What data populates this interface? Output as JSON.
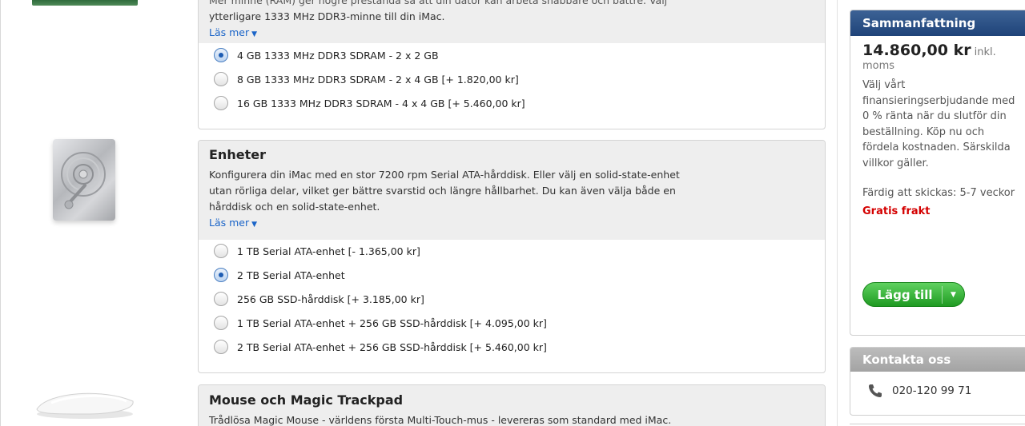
{
  "memory": {
    "desc_top": "Mer minne (RAM) ger högre prestanda så att din dator kan arbeta snabbare och bättre. Välj",
    "desc_line": "ytterligare 1333 MHz DDR3-minne till din iMac.",
    "learn_more": "Läs mer",
    "options": [
      {
        "label": "4 GB 1333 MHz DDR3 SDRAM - 2 x 2 GB",
        "checked": true
      },
      {
        "label": "8 GB 1333 MHz DDR3 SDRAM - 2 x 4 GB [+ 1.820,00 kr]",
        "checked": false
      },
      {
        "label": "16 GB 1333 MHz DDR3 SDRAM - 4 x 4 GB [+ 5.460,00 kr]",
        "checked": false
      }
    ]
  },
  "storage": {
    "title": "Enheter",
    "desc_lines": [
      "Konfigurera din iMac med en stor 7200 rpm Serial ATA-hårddisk. Eller välj en solid-state-enhet",
      "utan rörliga delar, vilket ger bättre svarstid och längre hållbarhet. Du kan även välja både en",
      "hårddisk och en solid-state-enhet."
    ],
    "learn_more": "Läs mer",
    "options": [
      {
        "label": "1 TB Serial ATA-enhet [- 1.365,00 kr]",
        "checked": false
      },
      {
        "label": "2 TB Serial ATA-enhet",
        "checked": true
      },
      {
        "label": "256 GB SSD-hårddisk [+ 3.185,00 kr]",
        "checked": false
      },
      {
        "label": "1 TB Serial ATA-enhet + 256 GB SSD-hårddisk [+ 4.095,00 kr]",
        "checked": false
      },
      {
        "label": "2 TB Serial ATA-enhet + 256 GB SSD-hårddisk [+ 5.460,00 kr]",
        "checked": false
      }
    ]
  },
  "mouse": {
    "title": "Mouse och Magic Trackpad",
    "desc": "Trådlösa Magic Mouse - världens första Multi-Touch-mus - levereras som standard med iMac."
  },
  "summary": {
    "header": "Sammanfattning",
    "price": "14.860,00 kr",
    "price_suffix": "inkl. moms",
    "finance_text": "Välj vårt finansieringserbjudande med 0 % ränta när du slutför din beställning. Köp nu och fördela kostnaden. Särskilda villkor gäller.",
    "ship_text": "Färdig att skickas: 5-7 veckor",
    "free_shipping": "Gratis frakt",
    "add_button": "Lägg till"
  },
  "contact": {
    "header": "Kontakta oss",
    "phone": "020-120 99 71"
  },
  "colors": {
    "summary_header": "#2b4f84",
    "link": "#1a64c8",
    "free_shipping": "#d40000",
    "add_button": "#2fab30"
  }
}
